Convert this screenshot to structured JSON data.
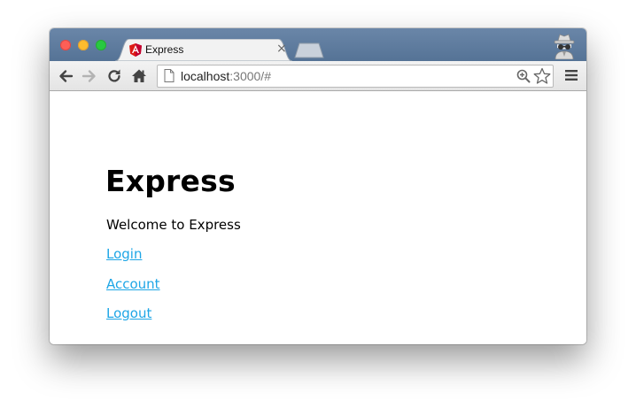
{
  "tab": {
    "title": "Express",
    "favicon": "angular-icon",
    "close_label": "×"
  },
  "address_bar": {
    "host": "localhost",
    "path": ":3000/#"
  },
  "toolbar": {
    "icons": [
      "back-icon",
      "forward-icon",
      "reload-icon",
      "home-icon",
      "page-icon",
      "zoom-icon",
      "star-icon",
      "menu-icon"
    ]
  },
  "page": {
    "title": "Express",
    "welcome": "Welcome to Express",
    "links": [
      {
        "label": "Login"
      },
      {
        "label": "Account"
      },
      {
        "label": "Logout"
      }
    ]
  },
  "colors": {
    "titlebar": "#5e7a9d",
    "link": "#1ea6e6",
    "angular_red": "#dd1b16"
  }
}
